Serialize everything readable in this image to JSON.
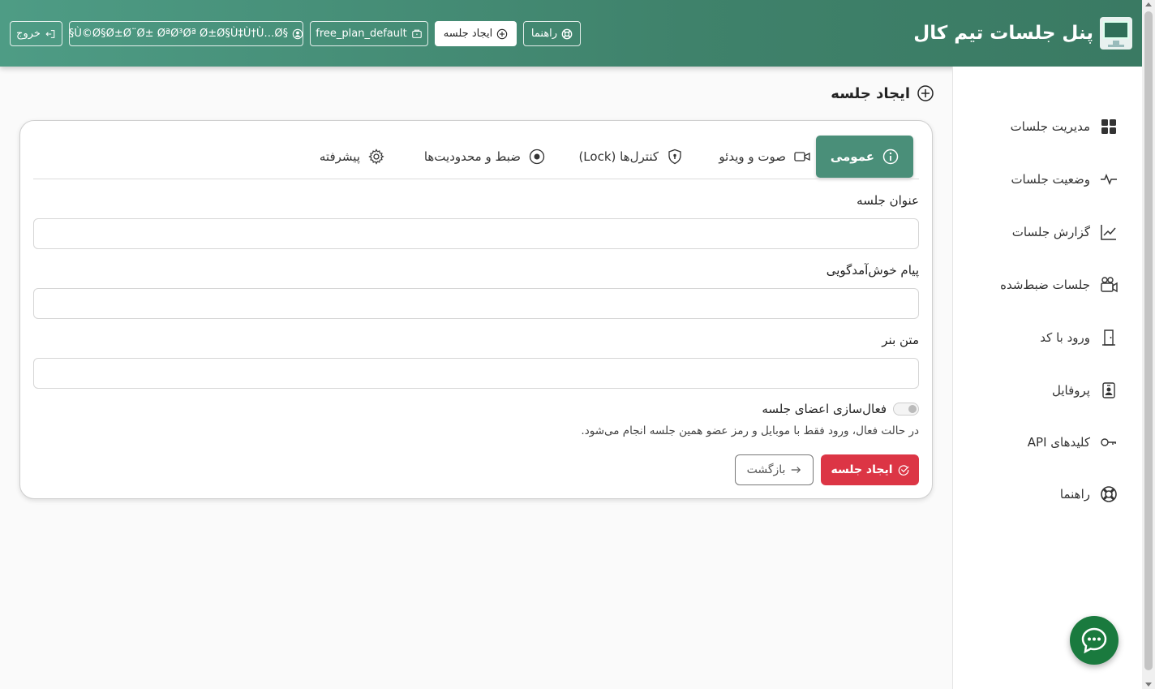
{
  "header": {
    "brand_title": "پنل جلسات تیم کال",
    "buttons": {
      "help": "راهنما",
      "create_session": "ایجاد جلسه",
      "plan": "free_plan_default",
      "user": "§Ù©Ø§Ø±Ø¨Ø± ØªØ³Øª Ø±Ø§Ù‡Ù†Ù…Ø§",
      "logout": "خروج"
    }
  },
  "sidebar": {
    "items": [
      {
        "label": "مدیریت جلسات",
        "icon": "grid-icon"
      },
      {
        "label": "وضعیت جلسات",
        "icon": "pulse-icon"
      },
      {
        "label": "گزارش جلسات",
        "icon": "chart-line-icon"
      },
      {
        "label": "جلسات ضبط‌شده",
        "icon": "camera-reels-icon"
      },
      {
        "label": "ورود با کد",
        "icon": "door-icon"
      },
      {
        "label": "پروفایل",
        "icon": "person-badge-icon"
      },
      {
        "label": "کلیدهای API",
        "icon": "key-icon"
      },
      {
        "label": "راهنما",
        "icon": "life-ring-icon"
      }
    ]
  },
  "main": {
    "page_title": "ایجاد جلسه",
    "tabs": [
      {
        "label": "عمومی",
        "icon": "info-icon",
        "active": true
      },
      {
        "label": "صوت و ویدئو",
        "icon": "video-icon"
      },
      {
        "label": "کنترل‌ها (Lock)",
        "icon": "shield-lock-icon"
      },
      {
        "label": "ضبط و محدودیت‌ها",
        "icon": "record-icon"
      },
      {
        "label": "پیشرفته",
        "icon": "gear-icon"
      }
    ],
    "form": {
      "title_label": "عنوان جلسه",
      "title_value": "",
      "welcome_label": "پیام خوش‌آمدگویی",
      "welcome_value": "",
      "banner_label": "متن بنر",
      "banner_value": "",
      "members_toggle_label": "فعال‌سازی اعضای جلسه",
      "members_toggle_on": false,
      "members_hint": "در حالت فعال، ورود فقط با موبایل و رمز عضو همین جلسه انجام می‌شود."
    },
    "actions": {
      "create_label": "ایجاد جلسه",
      "back_label": "بازگشت"
    }
  },
  "colors": {
    "header_start": "#4e9c85",
    "header_end": "#3a7a63",
    "active_tab": "#4a8f79",
    "create_button": "#dc3545",
    "chat_fab": "#1a7a3e"
  }
}
